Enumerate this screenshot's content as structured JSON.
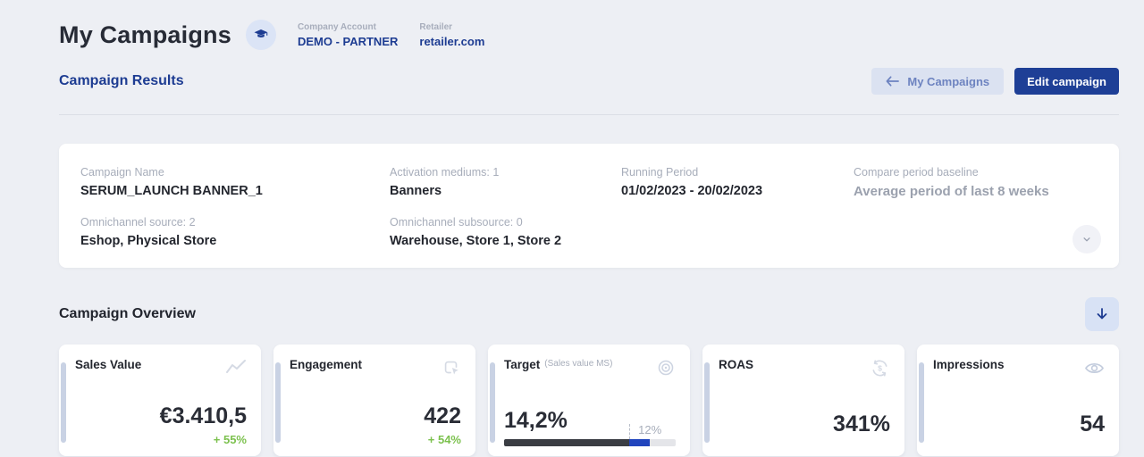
{
  "colors": {
    "brand_blue": "#1d3c92",
    "button_blue": "#1e3f96",
    "accent_strip": "#c9d2e4",
    "positive_green": "#7cc14e",
    "bar_dark": "#3a3d43",
    "bar_blue": "#2145bd",
    "page_background": "#edeff4"
  },
  "header": {
    "title": "My Campaigns",
    "company_account_label": "Company Account",
    "company_account_value": "DEMO - PARTNER",
    "retailer_label": "Retailer",
    "retailer_value": "retailer.com"
  },
  "toolbar": {
    "section_title": "Campaign Results",
    "back_button_label": "My Campaigns",
    "edit_button_label": "Edit campaign"
  },
  "campaign_info": {
    "fields": [
      {
        "label": "Campaign Name",
        "value": "SERUM_LAUNCH BANNER_1"
      },
      {
        "label": "Activation mediums: 1",
        "value": "Banners"
      },
      {
        "label": "Running Period",
        "value": "01/02/2023 - 20/02/2023"
      },
      {
        "label": "Compare period baseline",
        "value": "Average period of last 8 weeks"
      },
      {
        "label": "Omnichannel source: 2",
        "value": "Eshop, Physical Store"
      },
      {
        "label": "Omnichannel subsource: 0",
        "value": "Warehouse, Store 1, Store 2"
      }
    ]
  },
  "overview": {
    "title": "Campaign Overview"
  },
  "cards": [
    {
      "title": "Sales Value",
      "icon": "trend-line-icon",
      "value": "€3.410,5",
      "delta": "+ 55%"
    },
    {
      "title": "Engagement",
      "icon": "click-icon",
      "value": "422",
      "delta": "+ 54%"
    },
    {
      "title": "Target",
      "subtitle": "(Sales value MS)",
      "icon": "bullseye-icon",
      "value": "14,2%",
      "progress": {
        "dark_pct": 73,
        "blue_pct": 12,
        "marker_pct": 73,
        "marker_label": "12%"
      }
    },
    {
      "title": "ROAS",
      "icon": "currency-refresh-icon",
      "value": "341%"
    },
    {
      "title": "Impressions",
      "icon": "eye-icon",
      "value": "54"
    }
  ]
}
